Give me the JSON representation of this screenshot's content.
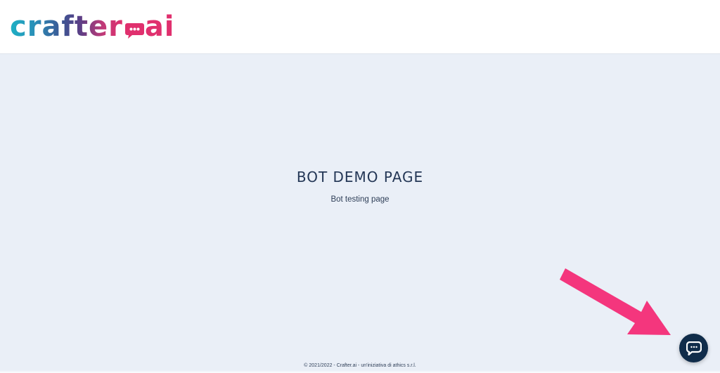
{
  "header": {
    "logo": {
      "word": "crafter",
      "suffix": "ai"
    }
  },
  "hero": {
    "title": "BOT DEMO PAGE",
    "subtitle": "Bot testing page"
  },
  "footer": {
    "text": "© 2021/2022 - Crafter.ai - un'iniziativa di athics s.r.l."
  },
  "chat_launcher": {
    "icon": "chat-bubble-icon"
  },
  "colors": {
    "header_bg": "#ffffff",
    "page_bg": "#eaeff7",
    "title_text": "#243756",
    "launcher_bg": "#102c4a",
    "arrow": "#f4367d",
    "logo_cyan": "#1db0c4",
    "logo_pink": "#e0306e"
  }
}
